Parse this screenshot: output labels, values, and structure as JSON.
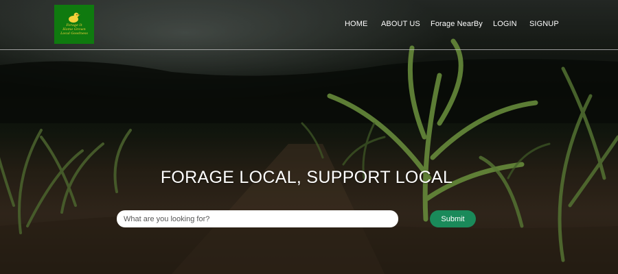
{
  "logo": {
    "line1": "Forage It",
    "line2": "Home Grown",
    "line3": "Local Goodness",
    "icon": "bird-icon"
  },
  "nav": {
    "home": "HOME",
    "about": "ABOUT US",
    "forage_nearby": "Forage NearBy",
    "login": "LOGIN",
    "signup": "SIGNUP"
  },
  "hero": {
    "title": "FORAGE LOCAL, SUPPORT LOCAL",
    "background": "corn-field-photo"
  },
  "search": {
    "placeholder": "What are you looking for?",
    "value": "",
    "submit_label": "Submit"
  },
  "colors": {
    "logo_bg": "#0f7a0f",
    "logo_accent": "#f3d23a",
    "submit_bg": "#1a8a5a",
    "nav_text": "#ffffff"
  }
}
